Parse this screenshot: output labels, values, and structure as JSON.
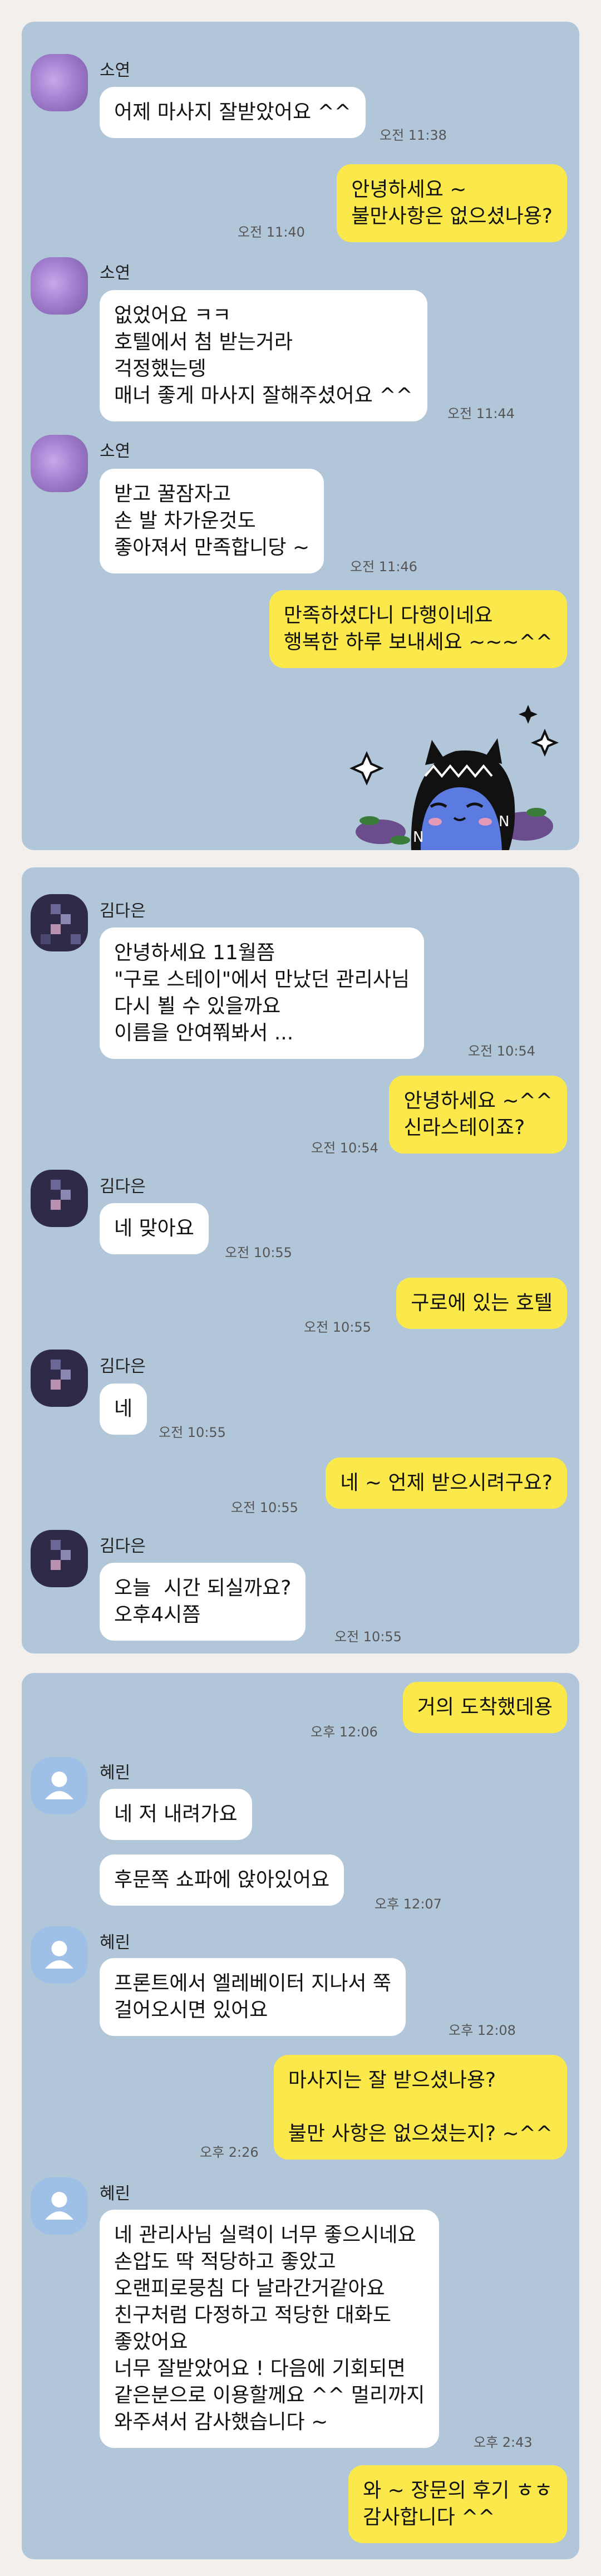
{
  "chat1": {
    "sender": "소연",
    "messages": [
      {
        "text": "어제 마사지 잘받았어요 ^^",
        "time": "오전 11:38"
      },
      {
        "text": "안녕하세요 ~\n불만사항은 없으셨나용?",
        "time": "오전 11:40"
      },
      {
        "text": "없었어요 ㅋㅋ\n호텔에서 첨 받는거라\n걱정했는뎅\n매너 좋게 마사지 잘해주셨어요 ^^",
        "time": "오전 11:44"
      },
      {
        "text": "받고 꿀잠자고\n손 발 차가운것도\n좋아져서 만족합니당 ~",
        "time": "오전 11:46"
      },
      {
        "text": "만족하셨다니 다행이네요\n행복한 하루 보내세요 ~~~^^",
        "time": ""
      }
    ]
  },
  "chat2": {
    "sender": "김다은",
    "messages": [
      {
        "text": "안녕하세요 11월쯤\n\"구로 스테이\"에서 만났던 관리사님\n다시 뵐 수 있을까요\n이름을 안여쭤봐서 ...",
        "time": "오전 10:54"
      },
      {
        "text": "안녕하세요 ~^^\n신라스테이죠?",
        "time": "오전 10:54"
      },
      {
        "text": "네 맞아요",
        "time": "오전 10:55"
      },
      {
        "text": "구로에 있는 호텔",
        "time": "오전 10:55"
      },
      {
        "text": "네",
        "time": "오전 10:55"
      },
      {
        "text": "네 ~ 언제 받으시려구요?",
        "time": "오전 10:55"
      },
      {
        "text": "오늘  시간 되실까요?\n오후4시쯤",
        "time": "오전 10:55"
      }
    ]
  },
  "chat3": {
    "sender": "혜린",
    "messages": [
      {
        "text": "거의 도착했데용",
        "time": "오후 12:06"
      },
      {
        "text": "네 저 내려가요",
        "time": ""
      },
      {
        "text": "후문쪽 쇼파에 앉아있어요",
        "time": "오후 12:07"
      },
      {
        "text": "프론트에서 엘레베이터 지나서 쭉\n걸어오시면 있어요",
        "time": "오후 12:08"
      },
      {
        "text": "마사지는 잘 받으셨나용?\n\n불만 사항은 없으셨는지? ~^^",
        "time": "오후 2:26"
      },
      {
        "text": "네 관리사님 실력이 너무 좋으시네요\n손압도 딱 적당하고 좋았고\n오랜피로뭉침 다 날라간거같아요\n친구처럼 다정하고 적당한 대화도\n좋았어요\n너무 잘받았어요 ! 다음에 기회되면\n같은분으로 이용할께요 ^^ 멀리까지\n와주셔서 감사했습니다 ~",
        "time": "오후 2:43"
      },
      {
        "text": "와 ~ 장문의 후기 ㅎㅎ\n감사합니다 ^^",
        "time": ""
      }
    ]
  }
}
